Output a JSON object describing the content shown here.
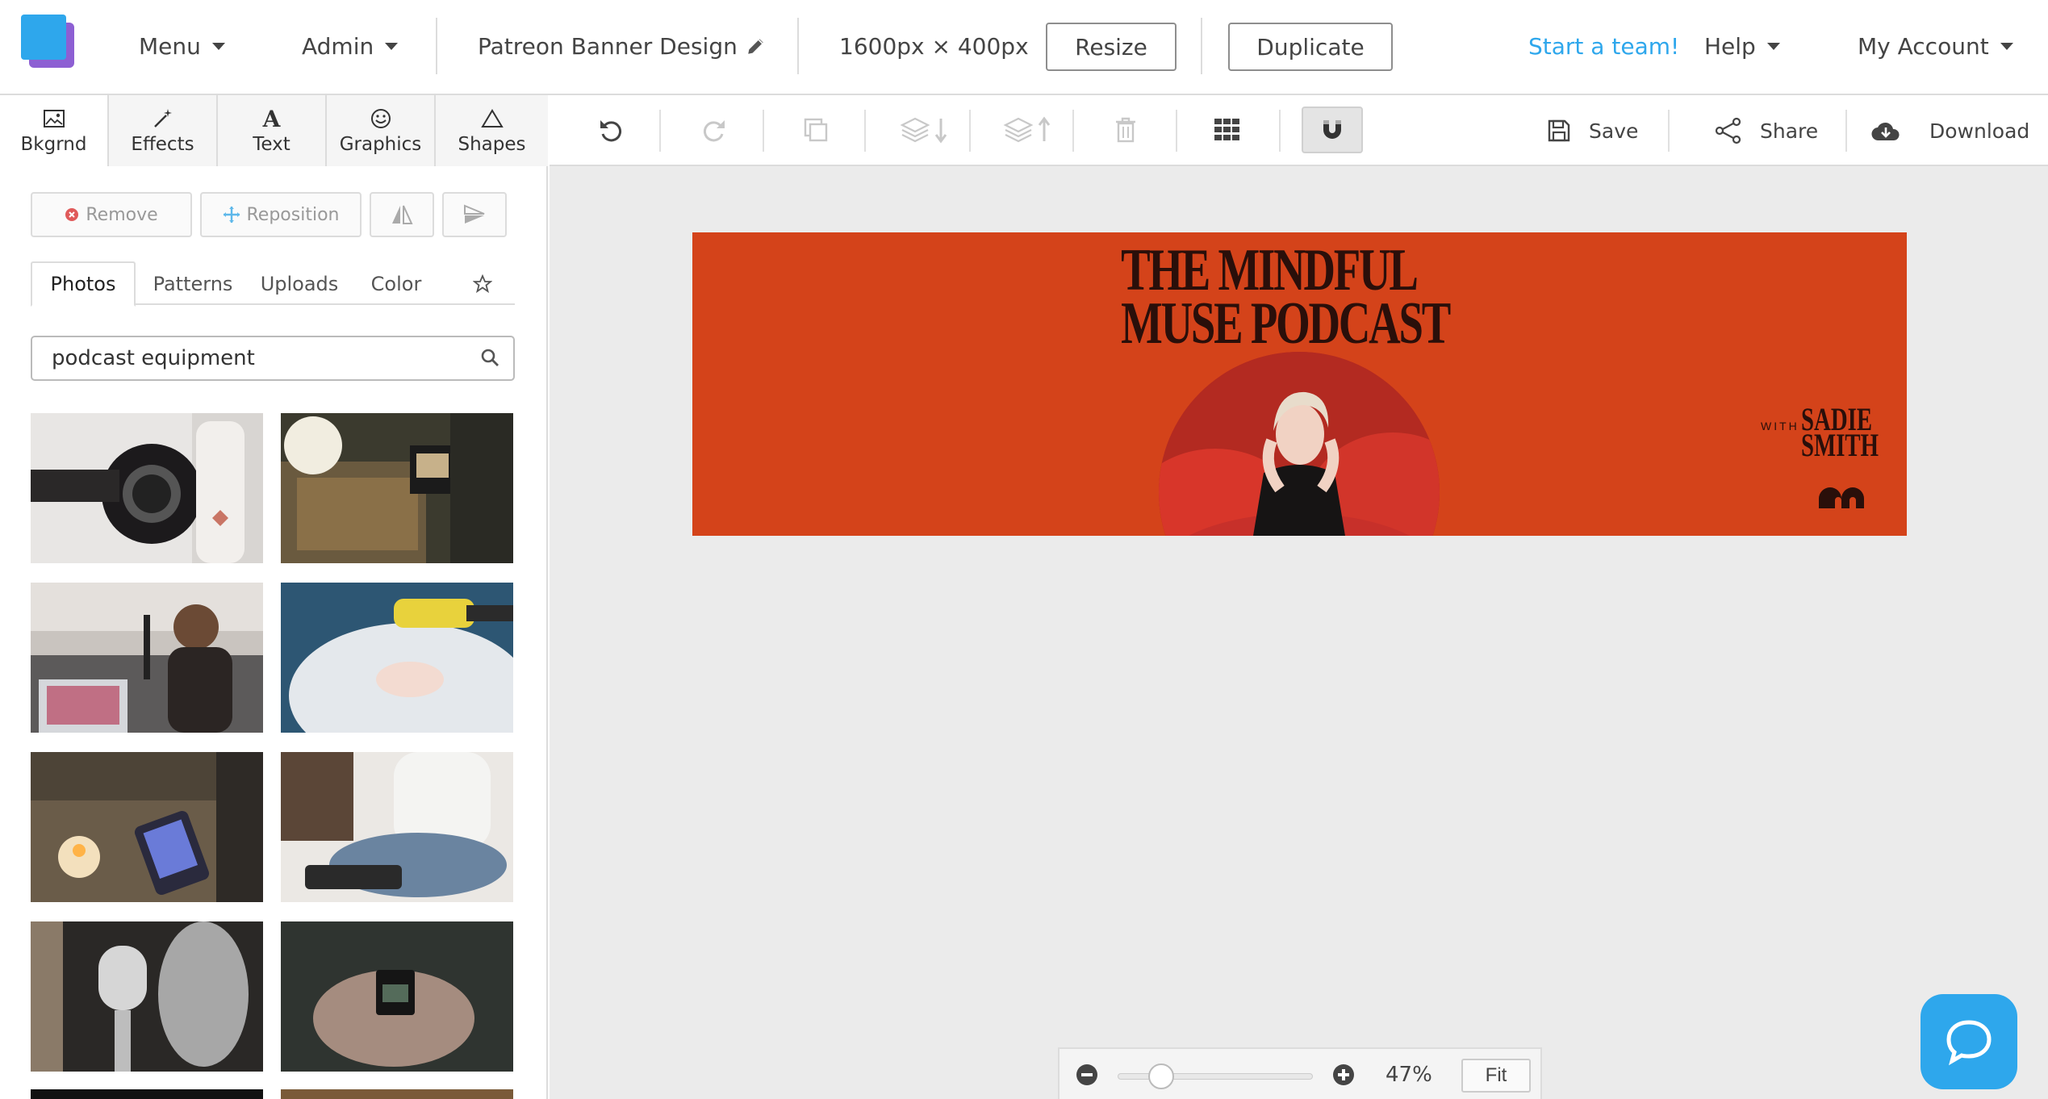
{
  "topbar": {
    "menu": "Menu",
    "admin": "Admin",
    "design_title": "Patreon Banner Design",
    "dimensions": "1600px × 400px",
    "resize": "Resize",
    "duplicate": "Duplicate",
    "start_team": "Start a team!",
    "help": "Help",
    "my_account": "My Account",
    "accent_color": "#2ea7ec"
  },
  "categories": [
    {
      "label": "Bkgrnd",
      "icon": "image-icon"
    },
    {
      "label": "Effects",
      "icon": "magic-wand-icon"
    },
    {
      "label": "Text",
      "icon": "text-a-icon"
    },
    {
      "label": "Graphics",
      "icon": "smiley-icon"
    },
    {
      "label": "Shapes",
      "icon": "triangle-icon"
    }
  ],
  "actions": {
    "remove": "Remove",
    "reposition": "Reposition"
  },
  "subtabs": [
    "Photos",
    "Patterns",
    "Uploads",
    "Color"
  ],
  "search": {
    "value": "podcast equipment"
  },
  "toolbar": {
    "save": "Save",
    "share": "Share",
    "download": "Download"
  },
  "banner": {
    "title_line1": "THE MINDFUL",
    "title_line2": "MUSE PODCAST",
    "host_with": "WITH",
    "host_name_line1": "SADIE",
    "host_name_line2": "SMITH",
    "background_color": "#d4431a"
  },
  "zoom": {
    "level": "47%",
    "fit": "Fit"
  }
}
